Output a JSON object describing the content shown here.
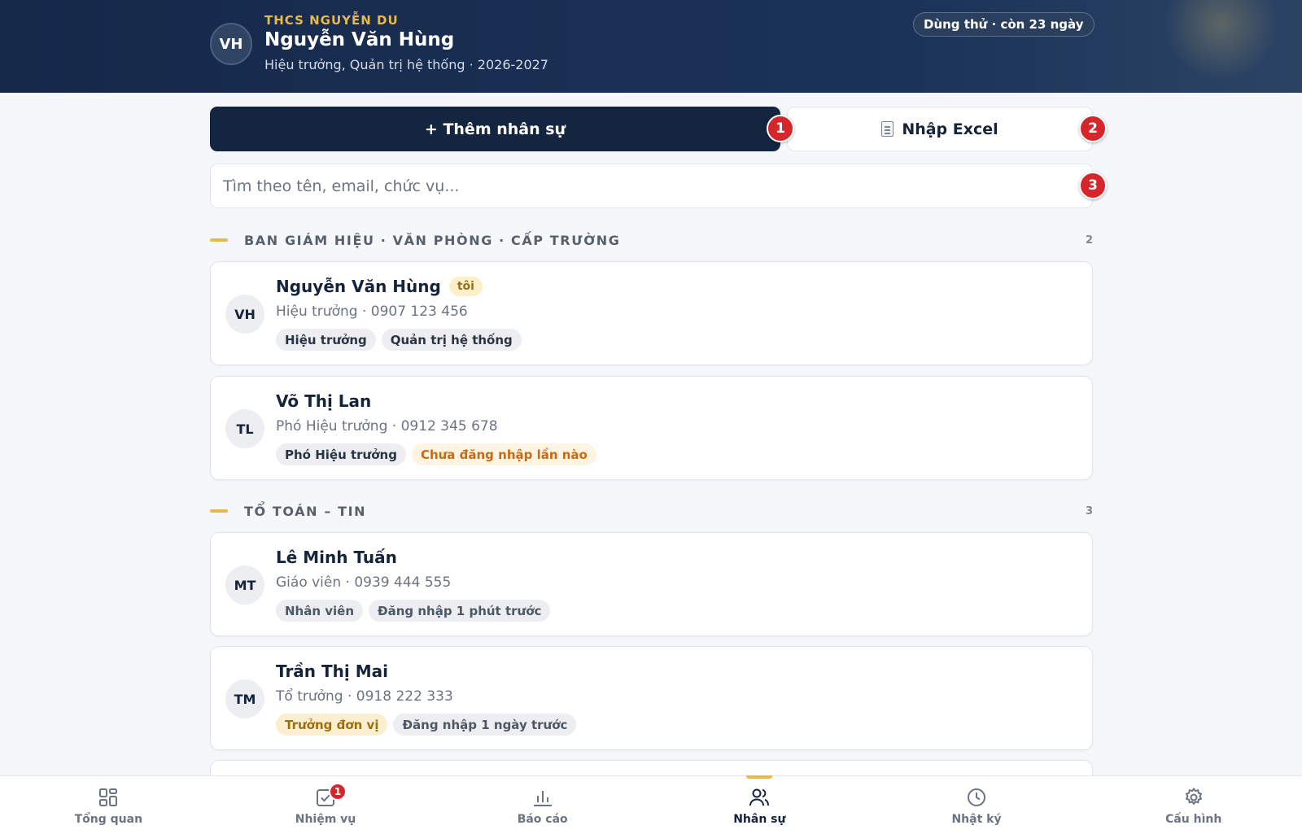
{
  "header": {
    "avatar_initials": "VH",
    "school": "THCS NGUYỄN DU",
    "user_name": "Nguyễn Văn Hùng",
    "user_role": "Hiệu trưởng, Quản trị hệ thống · 2026-2027",
    "trial_badge": "Dùng thử · còn 23 ngày"
  },
  "actions": {
    "add_label": "+ Thêm nhân sự",
    "import_label": "Nhập Excel",
    "search_placeholder": "Tìm theo tên, email, chức vụ..."
  },
  "markers": [
    "1",
    "2",
    "3"
  ],
  "sections": [
    {
      "title": "BAN GIÁM HIỆU · VĂN PHÒNG · CẤP TRƯỜNG",
      "count": "2",
      "staff": [
        {
          "initials": "VH",
          "name": "Nguyễn Văn Hùng",
          "me_badge": "tôi",
          "subtitle": "Hiệu trưởng · 0907 123 456",
          "tags": [
            {
              "label": "Hiệu trưởng",
              "style": "gray"
            },
            {
              "label": "Quản trị hệ thống",
              "style": "gray"
            }
          ]
        },
        {
          "initials": "TL",
          "name": "Võ Thị Lan",
          "subtitle": "Phó Hiệu trưởng · 0912 345 678",
          "tags": [
            {
              "label": "Phó Hiệu trưởng",
              "style": "gray"
            },
            {
              "label": "Chưa đăng nhập lần nào",
              "style": "warn"
            }
          ]
        }
      ]
    },
    {
      "title": "TỔ TOÁN – TIN",
      "count": "3",
      "staff": [
        {
          "initials": "MT",
          "name": "Lê Minh Tuấn",
          "subtitle": "Giáo viên · 0939 444 555",
          "tags": [
            {
              "label": "Nhân viên",
              "style": "gray2"
            },
            {
              "label": "Đăng nhập 1 phút trước",
              "style": "gray2"
            }
          ]
        },
        {
          "initials": "TM",
          "name": "Trần Thị Mai",
          "subtitle": "Tổ trưởng · 0918 222 333",
          "tags": [
            {
              "label": "Trưởng đơn vị",
              "style": "gold"
            },
            {
              "label": "Đăng nhập 1 ngày trước",
              "style": "gray2"
            }
          ]
        }
      ]
    }
  ],
  "bottom_nav": [
    {
      "label": "Tổng quan",
      "icon": "grid-icon"
    },
    {
      "label": "Nhiệm vụ",
      "icon": "task-check-icon",
      "badge": "1"
    },
    {
      "label": "Báo cáo",
      "icon": "bar-chart-icon"
    },
    {
      "label": "Nhân sự",
      "icon": "users-icon",
      "active": true
    },
    {
      "label": "Nhật ký",
      "icon": "clock-icon"
    },
    {
      "label": "Cấu hình",
      "icon": "gear-icon"
    }
  ],
  "colors": {
    "header_bg": "#16284a",
    "accent_gold": "#e6b94a",
    "primary_button": "#142540",
    "marker_red": "#d7262b",
    "warning_text": "#c96a12"
  }
}
